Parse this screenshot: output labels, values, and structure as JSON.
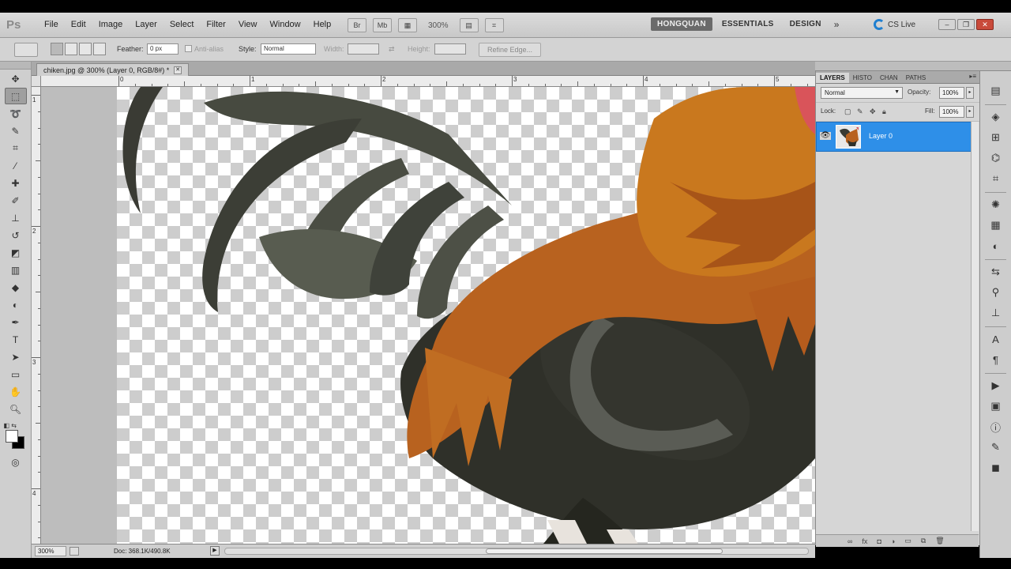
{
  "app": {
    "logo": "Ps",
    "menu": [
      "File",
      "Edit",
      "Image",
      "Layer",
      "Select",
      "Filter",
      "View",
      "Window",
      "Help"
    ],
    "zoom_display": "300%",
    "workspaces": [
      "HONGQUAN",
      "ESSENTIALS",
      "DESIGN"
    ],
    "workspaces_more": "»",
    "cs_live": "CS Live"
  },
  "options_bar": {
    "feather_label": "Feather:",
    "feather_value": "0 px",
    "anti_alias_label": "Anti-alias",
    "style_label": "Style:",
    "style_value": "Normal",
    "width_label": "Width:",
    "height_label": "Height:",
    "refine_edge_label": "Refine Edge..."
  },
  "document": {
    "tab_title": "chiken.jpg @ 300% (Layer 0, RGB/8#) *",
    "ruler_h_labels": [
      "0",
      "1",
      "2",
      "3",
      "4",
      "5"
    ],
    "ruler_v_labels": [
      "1",
      "2",
      "3",
      "4"
    ]
  },
  "statusbar": {
    "zoom": "300%",
    "doc_info": "Doc: 368.1K/490.8K"
  },
  "layers_panel": {
    "tabs": [
      "LAYERS",
      "HISTO",
      "CHAN",
      "PATHS"
    ],
    "blend_mode": "Normal",
    "opacity_label": "Opacity:",
    "opacity_value": "100%",
    "lock_label": "Lock:",
    "fill_label": "Fill:",
    "fill_value": "100%",
    "layers": [
      {
        "name": "Layer 0",
        "visible": true,
        "selected": true
      }
    ]
  },
  "colors": {
    "selection_blue": "#2e8fe8",
    "foreground": "#ffffff",
    "background": "#000000"
  }
}
